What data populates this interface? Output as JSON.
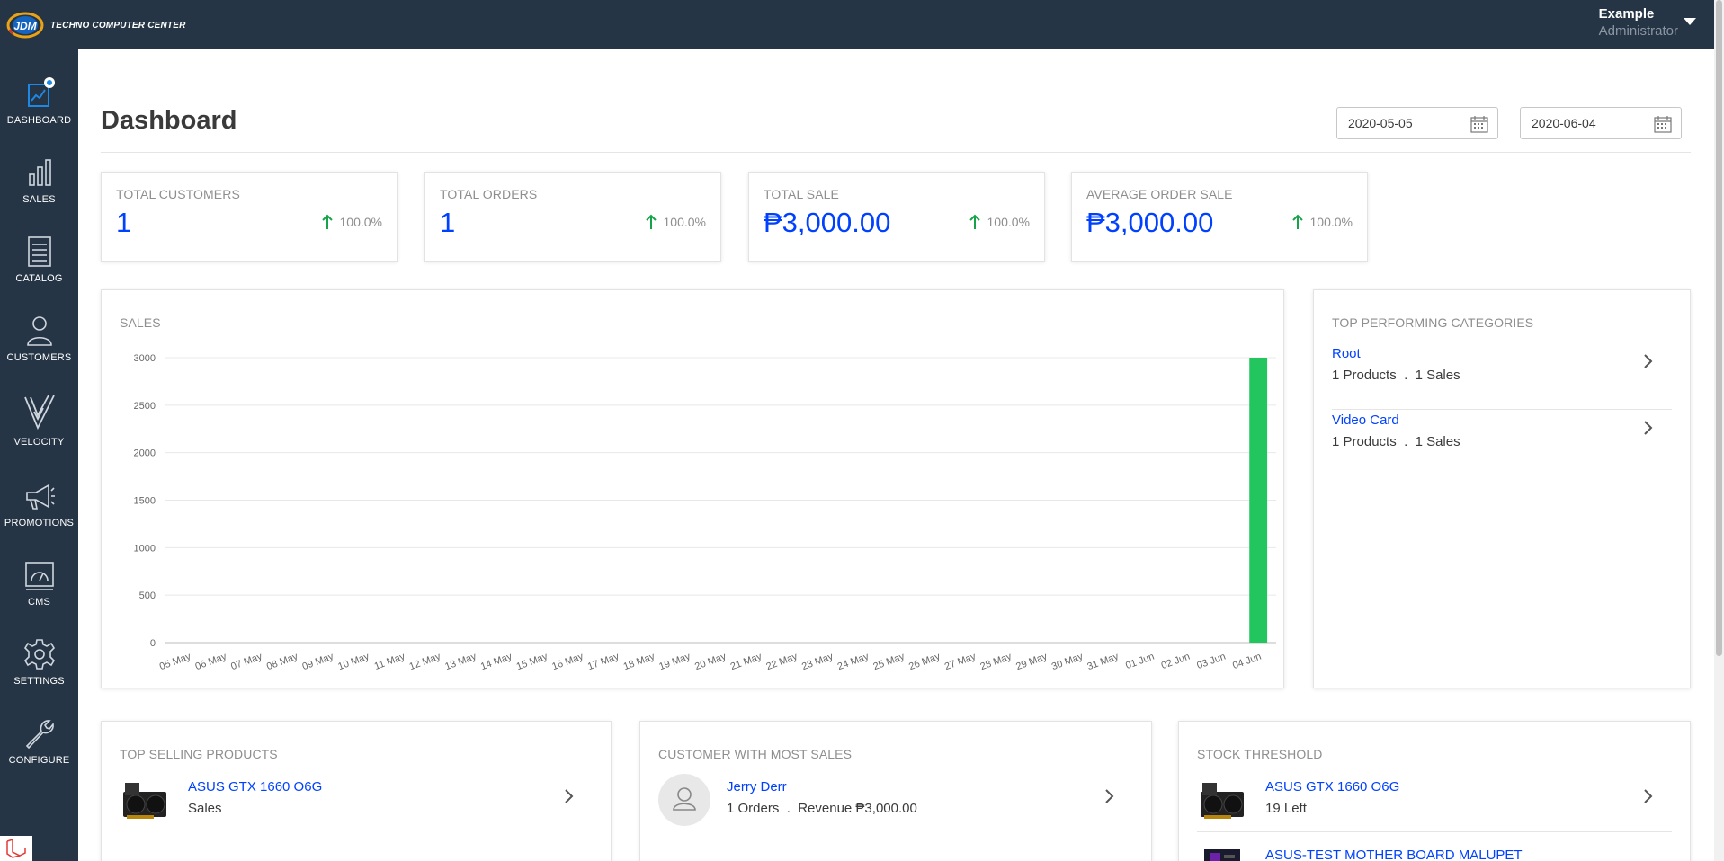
{
  "brand": {
    "logo_text": "TECHNO COMPUTER CENTER",
    "logo_badge": "JDM",
    "bar_color": "#263545"
  },
  "user": {
    "name": "Example",
    "role": "Administrator"
  },
  "sidebar": {
    "items": [
      {
        "label": "DASHBOARD",
        "icon": "dashboard-icon",
        "active": true
      },
      {
        "label": "SALES",
        "icon": "sales-bar-chart-icon"
      },
      {
        "label": "CATALOG",
        "icon": "catalog-list-icon"
      },
      {
        "label": "CUSTOMERS",
        "icon": "customer-person-icon"
      },
      {
        "label": "VELOCITY",
        "icon": "velocity-v-icon"
      },
      {
        "label": "PROMOTIONS",
        "icon": "megaphone-icon"
      },
      {
        "label": "CMS",
        "icon": "cms-gauge-icon"
      },
      {
        "label": "SETTINGS",
        "icon": "gear-icon"
      },
      {
        "label": "CONFIGURE",
        "icon": "wrench-icon"
      }
    ]
  },
  "page": {
    "title": "Dashboard",
    "start_date": "2020-05-05",
    "end_date": "2020-06-04"
  },
  "stats": [
    {
      "title": "TOTAL CUSTOMERS",
      "value": "1",
      "trend": "100.0%"
    },
    {
      "title": "TOTAL ORDERS",
      "value": "1",
      "trend": "100.0%"
    },
    {
      "title": "TOTAL SALE",
      "value": "₱3,000.00",
      "trend": "100.0%"
    },
    {
      "title": "AVERAGE ORDER SALE",
      "value": "₱3,000.00",
      "trend": "100.0%"
    }
  ],
  "sales_panel": {
    "title": "SALES"
  },
  "chart_data": {
    "type": "bar",
    "title": "SALES",
    "categories": [
      "05 May",
      "06 May",
      "07 May",
      "08 May",
      "09 May",
      "10 May",
      "11 May",
      "12 May",
      "13 May",
      "14 May",
      "15 May",
      "16 May",
      "17 May",
      "18 May",
      "19 May",
      "20 May",
      "21 May",
      "22 May",
      "23 May",
      "24 May",
      "25 May",
      "26 May",
      "27 May",
      "28 May",
      "29 May",
      "30 May",
      "31 May",
      "01 Jun",
      "02 Jun",
      "03 Jun",
      "04 Jun"
    ],
    "values": [
      0,
      0,
      0,
      0,
      0,
      0,
      0,
      0,
      0,
      0,
      0,
      0,
      0,
      0,
      0,
      0,
      0,
      0,
      0,
      0,
      0,
      0,
      0,
      0,
      0,
      0,
      0,
      0,
      0,
      0,
      3000
    ],
    "yticks": [
      0,
      500,
      1000,
      1500,
      2000,
      2500,
      3000
    ],
    "ylim": [
      0,
      3000
    ],
    "grid": true,
    "bar_color": "#22c55e"
  },
  "top_categories": {
    "title": "TOP PERFORMING CATEGORIES",
    "items": [
      {
        "name": "Root",
        "products": "1 Products",
        "sep": ".",
        "sales": "1 Sales"
      },
      {
        "name": "Video Card",
        "products": "1 Products",
        "sep": ".",
        "sales": "1 Sales"
      }
    ]
  },
  "top_selling": {
    "title": "TOP SELLING PRODUCTS",
    "items": [
      {
        "name": "ASUS GTX 1660 O6G",
        "sub": "Sales"
      }
    ]
  },
  "top_customer": {
    "title": "CUSTOMER WITH MOST SALES",
    "items": [
      {
        "name": "Jerry Derr",
        "orders": "1 Orders",
        "sep": ".",
        "revenue": "Revenue ₱3,000.00"
      }
    ]
  },
  "stock_threshold": {
    "title": "STOCK THRESHOLD",
    "items": [
      {
        "name": "ASUS GTX 1660 O6G",
        "sub": "19 Left"
      },
      {
        "name": "ASUS-TEST MOTHER BOARD MALUPET",
        "sub": ""
      }
    ]
  }
}
